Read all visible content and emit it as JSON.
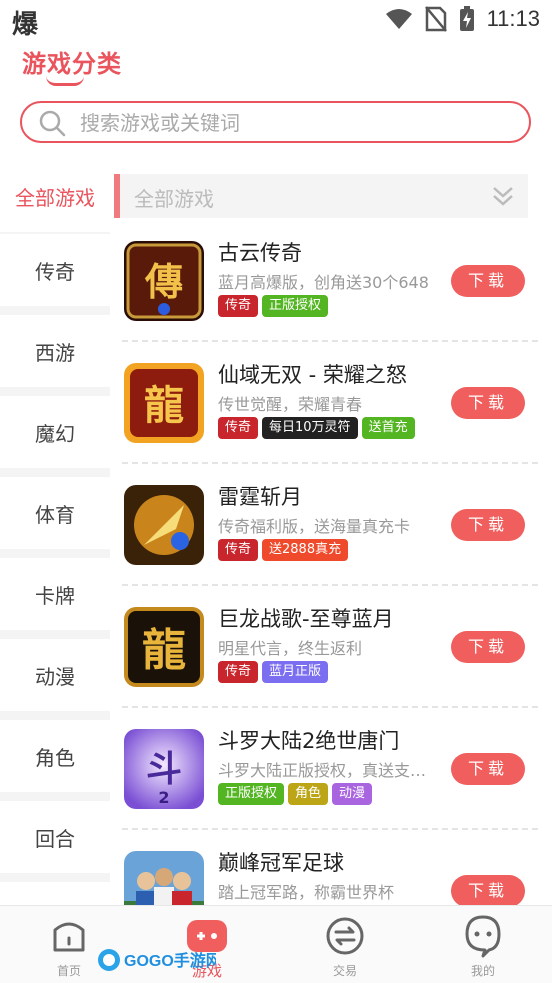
{
  "status_bar": {
    "left_glyph": "爆",
    "time": "11:13"
  },
  "header": {
    "title": "游戏分类"
  },
  "search": {
    "placeholder": "搜索游戏或关键词"
  },
  "sidebar": {
    "items": [
      {
        "label": "全部游戏",
        "active": true
      },
      {
        "label": "传奇"
      },
      {
        "label": "西游"
      },
      {
        "label": "魔幻"
      },
      {
        "label": "体育"
      },
      {
        "label": "卡牌"
      },
      {
        "label": "动漫"
      },
      {
        "label": "角色"
      },
      {
        "label": "回合"
      }
    ]
  },
  "category_filter": {
    "selected": "全部游戏"
  },
  "games": [
    {
      "name": "古云传奇",
      "desc": "蓝月高爆版，创角送30个648",
      "tags": [
        {
          "text": "传奇",
          "color": "#c8252c"
        },
        {
          "text": "正版授权",
          "color": "#52b521"
        }
      ],
      "button": "下载"
    },
    {
      "name": "仙域无双 - 荣耀之怒",
      "desc": "传世觉醒，荣耀青春",
      "tags": [
        {
          "text": "传奇",
          "color": "#c8252c"
        },
        {
          "text": "每日10万灵符",
          "color": "#222222"
        },
        {
          "text": "送首充",
          "color": "#52b521"
        }
      ],
      "button": "下载"
    },
    {
      "name": "雷霆斩月",
      "desc": "传奇福利版，送海量真充卡",
      "tags": [
        {
          "text": "传奇",
          "color": "#c8252c"
        },
        {
          "text": "送2888真充",
          "color": "#ef4a2b"
        }
      ],
      "button": "下载"
    },
    {
      "name": "巨龙战歌-至尊蓝月",
      "desc": "明星代言，终生返利",
      "tags": [
        {
          "text": "传奇",
          "color": "#c8252c"
        },
        {
          "text": "蓝月正版",
          "color": "#7b6ef0"
        }
      ],
      "button": "下载"
    },
    {
      "name": "斗罗大陆2绝世唐门",
      "desc": "斗罗大陆正版授权，真送支付宝",
      "tags": [
        {
          "text": "正版授权",
          "color": "#52b521"
        },
        {
          "text": "角色",
          "color": "#bca618"
        },
        {
          "text": "动漫",
          "color": "#a965e0"
        }
      ],
      "button": "下载"
    },
    {
      "name": "巅峰冠军足球",
      "desc": "踏上冠军路，称霸世界杯",
      "tags": [],
      "button": "下载"
    }
  ],
  "bottom_nav": [
    {
      "label": "首页",
      "icon": "home-icon"
    },
    {
      "label": "游戏",
      "icon": "gamepad-icon",
      "active": true
    },
    {
      "label": "交易",
      "icon": "trade-icon"
    },
    {
      "label": "我的",
      "icon": "profile-icon"
    }
  ],
  "watermark": "GOGO手游网",
  "colors": {
    "accent": "#e9545d",
    "download": "#f05f5e"
  }
}
